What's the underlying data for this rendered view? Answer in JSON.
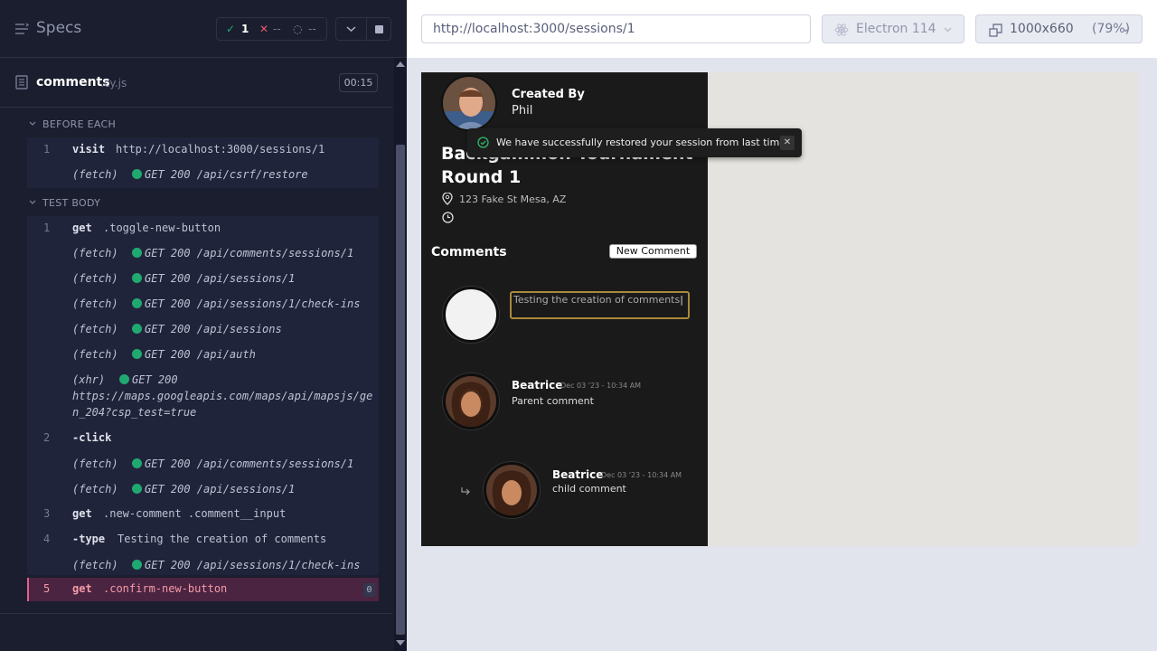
{
  "reporter": {
    "title": "Specs",
    "stats": {
      "passed": "1",
      "failed": "--",
      "pending": "--"
    },
    "file": {
      "name": "comments",
      "ext": ".cy.js",
      "duration": "00:15"
    },
    "before_each": {
      "label": "BEFORE EACH",
      "commands": [
        {
          "num": "1",
          "name": "visit",
          "message": "http://localhost:3000/sessions/1"
        },
        {
          "num": "",
          "name": "(fetch)",
          "message": "GET 200 /api/csrf/restore"
        }
      ]
    },
    "test_body": {
      "label": "TEST BODY",
      "commands": [
        {
          "num": "1",
          "name": "get",
          "message": ".toggle-new-button"
        },
        {
          "num": "",
          "name": "(fetch)",
          "message": "GET 200 /api/comments/sessions/1"
        },
        {
          "num": "",
          "name": "(fetch)",
          "message": "GET 200 /api/sessions/1"
        },
        {
          "num": "",
          "name": "(fetch)",
          "message": "GET 200 /api/sessions/1/check-ins"
        },
        {
          "num": "",
          "name": "(fetch)",
          "message": "GET 200 /api/sessions"
        },
        {
          "num": "",
          "name": "(fetch)",
          "message": "GET 200 /api/auth"
        },
        {
          "num": "",
          "name": "(xhr)",
          "message": "GET 200",
          "message2": "https://maps.googleapis.com/maps/api/mapsjs/ge",
          "message3": "n_204?csp_test=true"
        },
        {
          "num": "2",
          "name": "-click",
          "message": ""
        },
        {
          "num": "",
          "name": "(fetch)",
          "message": "GET 200 /api/comments/sessions/1"
        },
        {
          "num": "",
          "name": "(fetch)",
          "message": "GET 200 /api/sessions/1"
        },
        {
          "num": "3",
          "name": "get",
          "message": ".new-comment .comment__input"
        },
        {
          "num": "4",
          "name": "-type",
          "message": "Testing the creation of comments"
        },
        {
          "num": "",
          "name": "(fetch)",
          "message": "GET 200 /api/sessions/1/check-ins"
        }
      ],
      "active": {
        "num": "5",
        "name": "get",
        "message": ".confirm-new-button",
        "badge": "0"
      }
    }
  },
  "preview": {
    "url": "http://localhost:3000/sessions/1",
    "browser": "Electron 114",
    "viewport": "1000x660",
    "zoom": "(79%)"
  },
  "app": {
    "created_by_label": "Created By",
    "creator": "Phil",
    "toast": "We have successfully restored your session from last time.",
    "session_title_1": "Backgammon Tournament",
    "session_title_2": "Round 1",
    "address": "123 Fake St Mesa, AZ",
    "comments_heading": "Comments",
    "new_comment_button": "New Comment",
    "comment_input_value": "Testing the creation of comments",
    "comments": [
      {
        "author": "Beatrice",
        "date": "Dec 03 '23 - 10:34 AM",
        "text": "Parent comment"
      },
      {
        "author": "Beatrice",
        "date": "Dec 03 '23 - 10:34 AM",
        "text": "child comment"
      }
    ]
  }
}
